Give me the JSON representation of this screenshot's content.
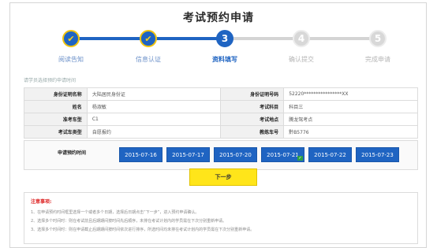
{
  "page": {
    "title": "考试预约申请"
  },
  "steps": [
    {
      "number": "1",
      "label": "阅读告知",
      "state": "done"
    },
    {
      "number": "2",
      "label": "信息认证",
      "state": "done"
    },
    {
      "number": "3",
      "label": "资料填写",
      "state": "active"
    },
    {
      "number": "4",
      "label": "确认提交",
      "state": "todo"
    },
    {
      "number": "5",
      "label": "完成申请",
      "state": "todo"
    }
  ],
  "step_done_icon": "check-icon",
  "section": {
    "subtitle": "请学员选择预约申请时间"
  },
  "info": {
    "id_type_label": "身份证明名称",
    "id_type_value": "大陆居民身份证",
    "id_no_label": "身份证明号码",
    "id_no_value": "52220****************XX",
    "name_label": "姓名",
    "name_value": "杨淑敏",
    "subject_label": "考试科目",
    "subject_value": "科目三",
    "vehicle_label": "准考车型",
    "vehicle_value": "C1",
    "site_label": "考试地点",
    "site_value": "腾龙驾考点",
    "exam_type_label": "考试车类型",
    "exam_type_value": "自愿报约",
    "coach_label": "教练车号",
    "coach_value": "黔B5776"
  },
  "appointment": {
    "label": "申请预约时间",
    "dates": [
      "2015-07-16",
      "2015-07-17",
      "2015-07-20",
      "2015-07-21",
      "2015-07-22",
      "2015-07-23"
    ],
    "selected_index": 3
  },
  "next_button": "下一步",
  "notes": {
    "title": "注意事项:",
    "items": [
      "1、在申请预约时间框里选择一个或者多个日期，选择后日期点击“下一步”，进入预约申请确认。",
      "2、选择多个时间时：则在考试前且后期期间按时间先后顺序，未排在考试计划内的学员需在下次分别重新申请。",
      "3、选择多个时间时：则在申请截止后期期间按时间依次进行排序，所选时间均未排在考试计划内的学员需在下次分别重新申请。"
    ]
  },
  "colors": {
    "primary": "#1f64c2",
    "accent": "#f1c40f",
    "button": "#ffe51a",
    "warning": "#dd2222"
  }
}
